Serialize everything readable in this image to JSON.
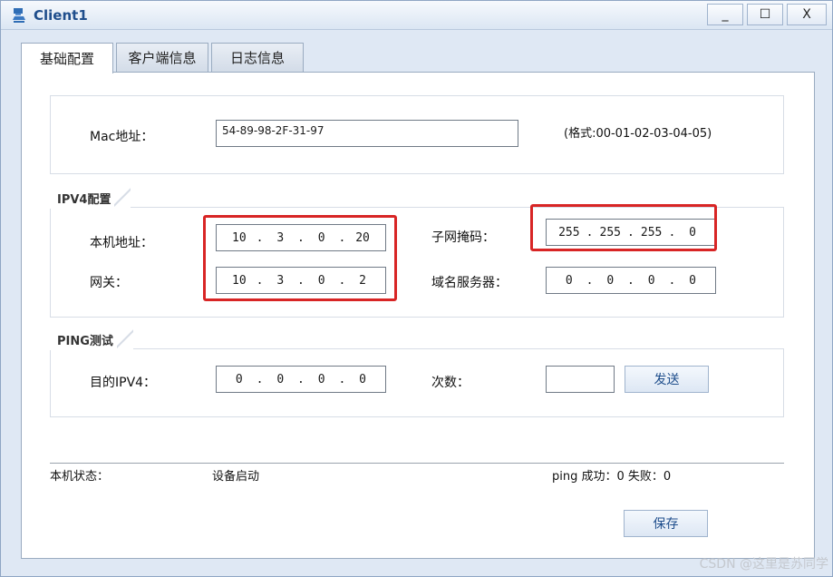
{
  "window": {
    "title": "Client1",
    "min_glyph": "_",
    "max_glyph": "☐",
    "close_glyph": "X"
  },
  "tabs": [
    {
      "label": "基础配置",
      "active": true
    },
    {
      "label": "客户端信息",
      "active": false
    },
    {
      "label": "日志信息",
      "active": false
    }
  ],
  "mac": {
    "label": "Mac地址：",
    "value": "54-89-98-2F-31-97",
    "hint": "(格式:00-01-02-03-04-05)"
  },
  "ipv4": {
    "legend": "IPV4配置",
    "local_label": "本机地址：",
    "local_ip": [
      "10",
      "3",
      "0",
      "20"
    ],
    "gateway_label": "网关：",
    "gateway_ip": [
      "10",
      "3",
      "0",
      "2"
    ],
    "mask_label": "子网掩码：",
    "mask_ip": [
      "255",
      "255",
      "255",
      "0"
    ],
    "dns_label": "域名服务器：",
    "dns_ip": [
      "0",
      "0",
      "0",
      "0"
    ]
  },
  "ping": {
    "legend": "PING测试",
    "target_label": "目的IPV4：",
    "target_ip": [
      "0",
      "0",
      "0",
      "0"
    ],
    "count_label": "次数：",
    "count_value": "",
    "send_label": "发送"
  },
  "status": {
    "label": "本机状态：",
    "value": "设备启动",
    "ping_result": "ping 成功：0 失败：0"
  },
  "save_label": "保存",
  "watermark": "CSDN @这里是苏同学",
  "colors": {
    "highlight": "#d82525",
    "accent": "#1f4e8c"
  }
}
